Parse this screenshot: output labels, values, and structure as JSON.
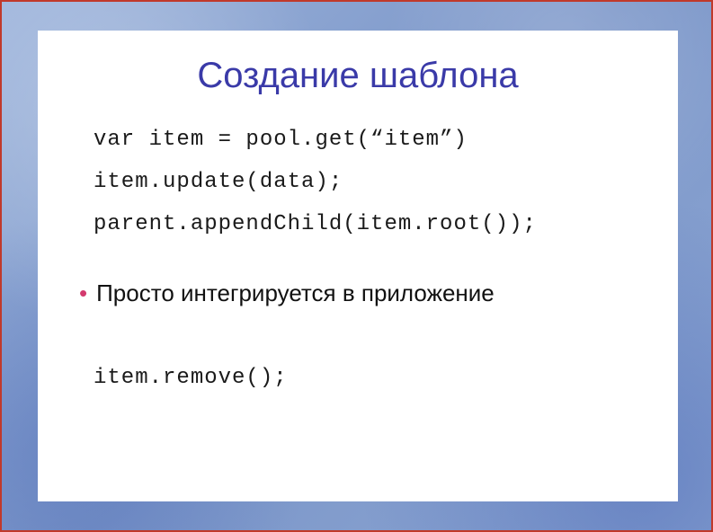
{
  "slide": {
    "title": "Создание шаблона",
    "code1_line1": "var item = pool.get(“item”)",
    "code1_line2": "item.update(data);",
    "code1_line3": "parent.appendChild(item.root());",
    "bullet1": "Просто интегрируется в приложение",
    "code2_line1": "item.remove();"
  }
}
